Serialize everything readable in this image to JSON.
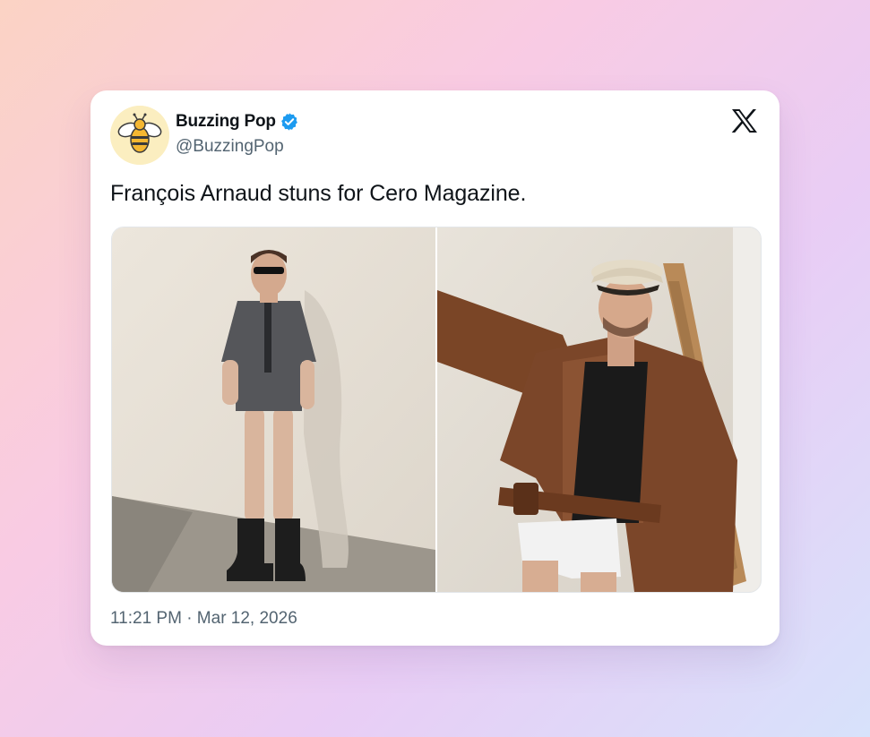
{
  "tweet": {
    "author": {
      "display_name": "Buzzing Pop",
      "handle": "@BuzzingPop",
      "verified": true,
      "avatar_icon": "bee-icon"
    },
    "text": "François Arnaud stuns for Cero Magazine.",
    "timestamp": "11:21 PM · Mar 12, 2026",
    "platform_icon": "x-logo-icon",
    "media": [
      {
        "kind": "photo",
        "description_icon": "photo-1"
      },
      {
        "kind": "photo",
        "description_icon": "photo-2"
      }
    ]
  },
  "colors": {
    "verified_badge": "#1d9bf0",
    "text_primary": "#0f1419",
    "text_secondary": "#536471",
    "avatar_bg": "#fbeec0"
  }
}
